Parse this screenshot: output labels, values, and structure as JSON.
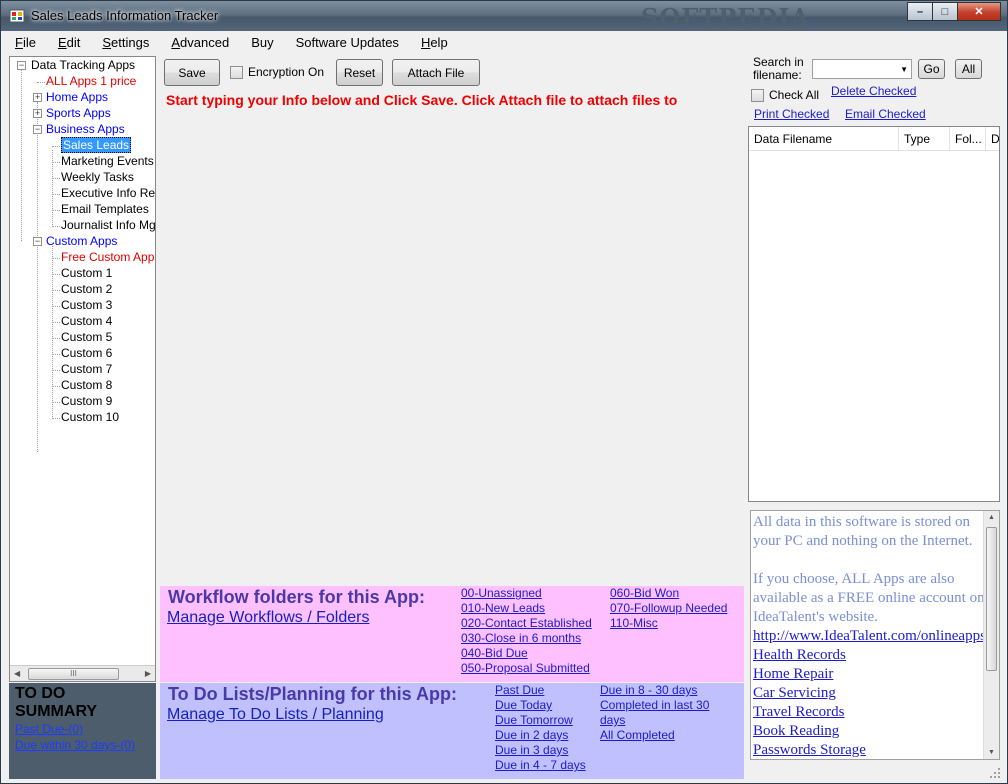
{
  "window": {
    "title": "Sales Leads Information Tracker",
    "watermark": "SOFTPEDIA",
    "minimize": "–",
    "maximize": "□",
    "close": "✕"
  },
  "menu": [
    {
      "label": "File",
      "underline": "F",
      "rest": "ile"
    },
    {
      "label": "Edit",
      "underline": "E",
      "rest": "dit"
    },
    {
      "label": "Settings",
      "underline": "S",
      "rest": "ettings"
    },
    {
      "label": "Advanced",
      "underline": "A",
      "rest": "dvanced"
    },
    {
      "label": "Buy",
      "underline": "",
      "rest": "Buy"
    },
    {
      "label": "Software Updates",
      "underline": "",
      "rest": "Software Updates"
    },
    {
      "label": "Help",
      "underline": "H",
      "rest": "elp"
    }
  ],
  "tree": {
    "root": "Data Tracking Apps",
    "all_apps": "ALL Apps 1 price",
    "home_apps": "Home Apps",
    "sports_apps": "Sports Apps",
    "business_apps": "Business Apps",
    "business_items": [
      "Sales Leads",
      "Marketing Events",
      "Weekly Tasks",
      "Executive Info Reco",
      "Email Templates",
      "Journalist Info Mgmt"
    ],
    "custom_apps": "Custom Apps",
    "free_custom": "Free Custom Apps -",
    "custom_items": [
      "Custom 1",
      "Custom 2",
      "Custom 3",
      "Custom 4",
      "Custom 5",
      "Custom 6",
      "Custom 7",
      "Custom 8",
      "Custom 9",
      "Custom 10"
    ],
    "selected": "Sales Leads",
    "scroll_grip": "III"
  },
  "todo_summary": {
    "title_line1": "TO DO",
    "title_line2": "SUMMARY",
    "past_due": "Past Due-(0)",
    "due_30": "Due within 30 days-(0)"
  },
  "toolbar": {
    "save": "Save",
    "encryption": "Encryption On",
    "reset": "Reset",
    "attach": "Attach File"
  },
  "instructions": "Start typing your Info below and Click Save. Click Attach file to attach files to",
  "workflow": {
    "title": "Workflow folders for this App:",
    "manage": "Manage Workflows / Folders",
    "col1": [
      "00-Unassigned",
      "010-New Leads",
      "020-Contact Established",
      "030-Close in 6 months",
      "040-Bid Due",
      "050-Proposal Submitted"
    ],
    "col2": [
      "060-Bid Won",
      "070-Followup Needed",
      "110-Misc"
    ],
    "bg_color": "#ffc0ff"
  },
  "todo_plan": {
    "title": "To Do Lists/Planning for this App:",
    "manage": "Manage To Do Lists / Planning",
    "col1": [
      "Past Due",
      "Due Today",
      "Due Tomorrow",
      "Due in 2 days",
      "Due in 3 days",
      "Due in 4 - 7 days"
    ],
    "col2": [
      "Due in 8 - 30 days",
      "Completed in last 30",
      "days",
      "All Completed"
    ],
    "bg_color": "#c0c0ff"
  },
  "search": {
    "label_line1": "Search in",
    "label_line2": "filename:",
    "value": "",
    "go": "Go",
    "all": "All",
    "check_all": "Check All",
    "delete_checked": "Delete Checked",
    "print_checked": "Print Checked",
    "email_checked": "Email Checked"
  },
  "file_list": {
    "columns": [
      "Data Filename",
      "Type",
      "Fol...",
      "Da"
    ]
  },
  "info": {
    "para1": "All data in this software is stored on your PC and nothing on the Internet.",
    "para2": "If you choose, ALL Apps are also available as a FREE online account on IdeaTalent's website.",
    "url": "http://www.IdeaTalent.com/onlineapps",
    "links": [
      "Health Records",
      "Home Repair",
      "Car Servicing",
      "Travel Records",
      "Book Reading",
      "Passwords Storage"
    ]
  }
}
